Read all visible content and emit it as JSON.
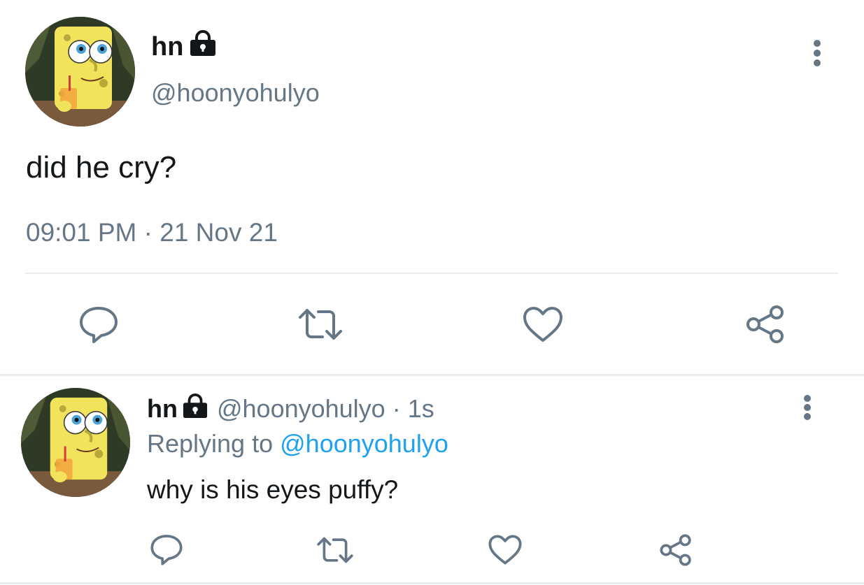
{
  "main_tweet": {
    "display_name": "hn",
    "handle": "@hoonyohulyo",
    "text": "did he cry?",
    "timestamp": "09:01 PM · 21 Nov 21",
    "protected_icon": "lock-icon",
    "actions": [
      "reply-icon",
      "retweet-icon",
      "like-icon",
      "share-icon"
    ]
  },
  "reply_tweet": {
    "display_name": "hn",
    "handle": "@hoonyohulyo",
    "separator": "·",
    "time_ago": "1s",
    "replying_to_label": "Replying to",
    "replying_to_handle": "@hoonyohulyo",
    "text": "why is his eyes puffy?",
    "protected_icon": "lock-icon",
    "actions": [
      "reply-icon",
      "retweet-icon",
      "like-icon",
      "share-icon"
    ]
  },
  "colors": {
    "text_primary": "#14171a",
    "text_secondary": "#657786",
    "link": "#1da1f2",
    "divider": "#e6ecf0"
  }
}
